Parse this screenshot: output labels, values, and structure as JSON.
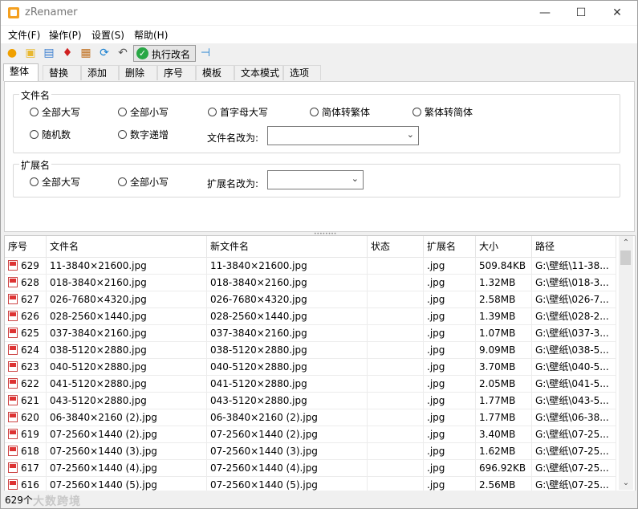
{
  "window": {
    "title": "zRenamer"
  },
  "menu": [
    "文件(F)",
    "操作(P)",
    "设置(S)",
    "帮助(H)"
  ],
  "toolbar": {
    "execute_label": "执行改名"
  },
  "tabs": [
    "整体",
    "替换",
    "添加",
    "删除",
    "序号",
    "模板",
    "文本模式",
    "选项"
  ],
  "filename_group": {
    "title": "文件名",
    "options": [
      "全部大写",
      "全部小写",
      "首字母大写",
      "简体转繁体",
      "繁体转简体",
      "随机数",
      "数字递增"
    ],
    "change_label": "文件名改为:",
    "change_value": ""
  },
  "ext_group": {
    "title": "扩展名",
    "options": [
      "全部大写",
      "全部小写"
    ],
    "change_label": "扩展名改为:",
    "change_value": ""
  },
  "table": {
    "columns": [
      "序号",
      "文件名",
      "新文件名",
      "状态",
      "扩展名",
      "大小",
      "路径"
    ],
    "rows": [
      {
        "no": "629",
        "name": "11-3840×21600.jpg",
        "newname": "11-3840×21600.jpg",
        "status": "",
        "ext": ".jpg",
        "size": "509.84KB",
        "path": "G:\\壁纸\\11-38..."
      },
      {
        "no": "628",
        "name": "018-3840×2160.jpg",
        "newname": "018-3840×2160.jpg",
        "status": "",
        "ext": ".jpg",
        "size": "1.32MB",
        "path": "G:\\壁纸\\018-3..."
      },
      {
        "no": "627",
        "name": "026-7680×4320.jpg",
        "newname": "026-7680×4320.jpg",
        "status": "",
        "ext": ".jpg",
        "size": "2.58MB",
        "path": "G:\\壁纸\\026-7..."
      },
      {
        "no": "626",
        "name": "028-2560×1440.jpg",
        "newname": "028-2560×1440.jpg",
        "status": "",
        "ext": ".jpg",
        "size": "1.39MB",
        "path": "G:\\壁纸\\028-2..."
      },
      {
        "no": "625",
        "name": "037-3840×2160.jpg",
        "newname": "037-3840×2160.jpg",
        "status": "",
        "ext": ".jpg",
        "size": "1.07MB",
        "path": "G:\\壁纸\\037-3..."
      },
      {
        "no": "624",
        "name": "038-5120×2880.jpg",
        "newname": "038-5120×2880.jpg",
        "status": "",
        "ext": ".jpg",
        "size": "9.09MB",
        "path": "G:\\壁纸\\038-5..."
      },
      {
        "no": "623",
        "name": "040-5120×2880.jpg",
        "newname": "040-5120×2880.jpg",
        "status": "",
        "ext": ".jpg",
        "size": "3.70MB",
        "path": "G:\\壁纸\\040-5..."
      },
      {
        "no": "622",
        "name": "041-5120×2880.jpg",
        "newname": "041-5120×2880.jpg",
        "status": "",
        "ext": ".jpg",
        "size": "2.05MB",
        "path": "G:\\壁纸\\041-5..."
      },
      {
        "no": "621",
        "name": "043-5120×2880.jpg",
        "newname": "043-5120×2880.jpg",
        "status": "",
        "ext": ".jpg",
        "size": "1.77MB",
        "path": "G:\\壁纸\\043-5..."
      },
      {
        "no": "620",
        "name": "06-3840×2160 (2).jpg",
        "newname": "06-3840×2160 (2).jpg",
        "status": "",
        "ext": ".jpg",
        "size": "1.77MB",
        "path": "G:\\壁纸\\06-38..."
      },
      {
        "no": "619",
        "name": "07-2560×1440 (2).jpg",
        "newname": "07-2560×1440 (2).jpg",
        "status": "",
        "ext": ".jpg",
        "size": "3.40MB",
        "path": "G:\\壁纸\\07-25..."
      },
      {
        "no": "618",
        "name": "07-2560×1440 (3).jpg",
        "newname": "07-2560×1440 (3).jpg",
        "status": "",
        "ext": ".jpg",
        "size": "1.62MB",
        "path": "G:\\壁纸\\07-25..."
      },
      {
        "no": "617",
        "name": "07-2560×1440 (4).jpg",
        "newname": "07-2560×1440 (4).jpg",
        "status": "",
        "ext": ".jpg",
        "size": "696.92KB",
        "path": "G:\\壁纸\\07-25..."
      },
      {
        "no": "616",
        "name": "07-2560×1440 (5).jpg",
        "newname": "07-2560×1440 (5).jpg",
        "status": "",
        "ext": ".jpg",
        "size": "2.56MB",
        "path": "G:\\壁纸\\07-25..."
      }
    ]
  },
  "status": {
    "count": "629个",
    "watermark": "大数跨境"
  }
}
